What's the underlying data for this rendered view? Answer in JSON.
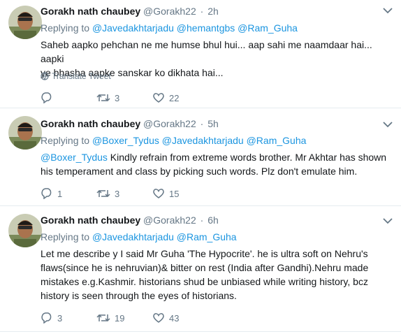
{
  "tweets": [
    {
      "name": "Gorakh nath chaubey",
      "handle": "@Gorakh22",
      "sep": "·",
      "time": "2h",
      "replying_label": "Replying to",
      "mentions": [
        "@Javedakhtarjadu",
        "@hemantgbs",
        "@Ram_Guha"
      ],
      "lead_mention": "",
      "text_lines": [
        "Saheb aapko pehchan ne me humse bhul hui... aap sahi me naamdaar hai... aapki",
        "ye bhasha aapke sanskar ko dikhata hai..."
      ],
      "translate": "Translate Tweet",
      "replies": "",
      "retweets": "3",
      "likes": "22"
    },
    {
      "name": "Gorakh nath chaubey",
      "handle": "@Gorakh22",
      "sep": "·",
      "time": "5h",
      "replying_label": "Replying to",
      "mentions": [
        "@Boxer_Tydus",
        "@Javedakhtarjadu",
        "@Ram_Guha"
      ],
      "lead_mention": "@Boxer_Tydus",
      "text_lines": [
        " Kindly refrain from extreme words brother. Mr Akhtar has shown",
        "his temperament and class by picking such words. Plz don't emulate him."
      ],
      "translate": "",
      "replies": "1",
      "retweets": "3",
      "likes": "15"
    },
    {
      "name": "Gorakh nath chaubey",
      "handle": "@Gorakh22",
      "sep": "·",
      "time": "6h",
      "replying_label": "Replying to",
      "mentions": [
        "@Javedakhtarjadu",
        "@Ram_Guha"
      ],
      "lead_mention": "",
      "text_lines": [
        "Let me describe y I said Mr Guha 'The Hypocrite'. he is ultra soft on Nehru's",
        "flaws(since he is nehruvian)& bitter on rest (India after Gandhi).Nehru made",
        "mistakes e.g.Kashmir. historians shud be unbiased while writing history, bcz",
        "history is seen through the eyes of historians."
      ],
      "translate": "",
      "replies": "3",
      "retweets": "19",
      "likes": "43"
    }
  ],
  "colors": {
    "link": "#1b95e0",
    "muted": "#657786",
    "text": "#14171a",
    "divider": "#e6ecf0"
  },
  "icons": {
    "reply": "reply-icon",
    "retweet": "retweet-icon",
    "like": "heart-icon",
    "more": "chevron-down-icon",
    "translate": "globe-icon"
  }
}
